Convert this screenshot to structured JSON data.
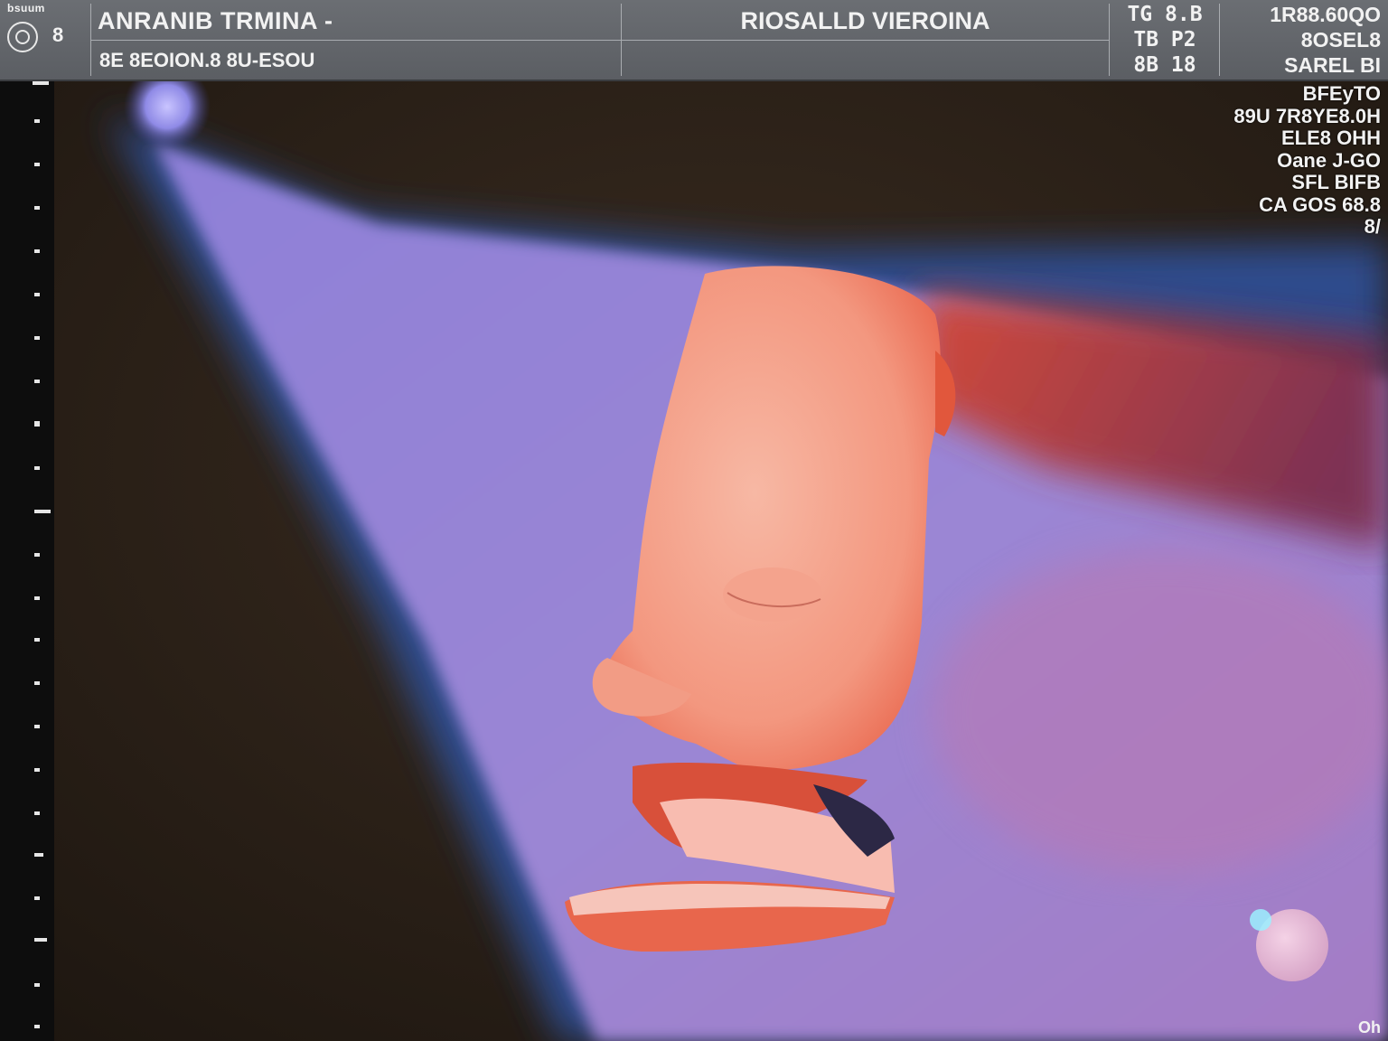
{
  "header": {
    "logo_label": "bsuum",
    "logo_number": "8",
    "title_main": "ANRANIB TRMINA -",
    "title_sub": "8E 8EOION.8  8U-ESOU",
    "center_title": "RIOSALLD VIEROINA",
    "params": [
      "TG  8.B",
      "TB  P2",
      "8B  18"
    ],
    "right_lines": [
      "1R88.60QO",
      "8OSEL8",
      "SAREL BI"
    ]
  },
  "info_column": {
    "lines": [
      "BFEyTO",
      "89U 7R8YE8.0H",
      "ELE8 OHH",
      "Oane J-GO",
      "SFL BIFB",
      "CA GOS 68.8",
      "8/"
    ]
  },
  "corner_label": "Oh",
  "colors": {
    "header_bg": "#62656a",
    "background": "#2b2016",
    "sector_blue": "#2f4c8c",
    "sector_lilac": "#9a8ad6",
    "face_peach": "#f6a68f",
    "face_red": "#e2553a"
  },
  "icons": [
    "logo-icon",
    "bright-spot-icon"
  ]
}
